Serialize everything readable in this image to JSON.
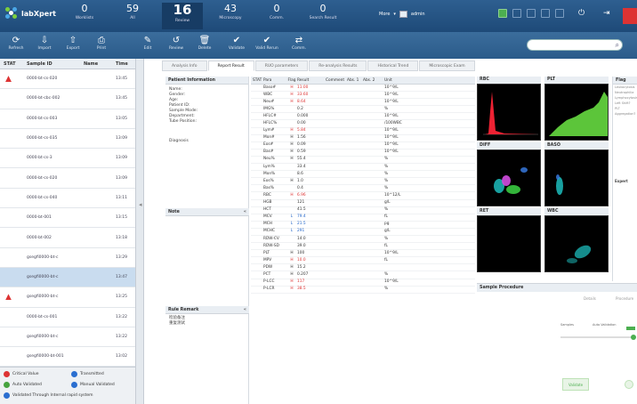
{
  "app": {
    "name": "labXpert",
    "colors": {
      "header": "#1e4a78",
      "accent": "#4caf50",
      "alert": "#d33333",
      "selected_row": "#c9dcef"
    }
  },
  "header": {
    "stats": [
      {
        "value": "0",
        "label": "Worklists"
      },
      {
        "value": "59",
        "label": "All"
      },
      {
        "value": "16",
        "label": "Review",
        "active": true
      },
      {
        "value": "43",
        "label": "Microscopy"
      },
      {
        "value": "0",
        "label": "Comm."
      },
      {
        "value": "0",
        "label": "Search Result"
      }
    ],
    "mode": "More",
    "user": "admin"
  },
  "toolbar": {
    "buttons": [
      {
        "label": "Refresh",
        "icon": "refresh-icon"
      },
      {
        "label": "Import",
        "icon": "import-icon"
      },
      {
        "label": "Export",
        "icon": "export-icon"
      },
      {
        "label": "Print",
        "icon": "print-icon"
      },
      {
        "label": "Edit",
        "icon": "edit-icon"
      },
      {
        "label": "Review",
        "icon": "review-icon"
      },
      {
        "label": "Delete",
        "icon": "delete-icon"
      },
      {
        "label": "Validate",
        "icon": "validate-icon"
      },
      {
        "label": "Valid Rerun",
        "icon": "valid-rerun-icon"
      },
      {
        "label": "Comm.",
        "icon": "communication-icon"
      }
    ]
  },
  "sample_list": {
    "columns": [
      "STAT",
      "Sample ID",
      "Name",
      "Time"
    ],
    "rows": [
      {
        "flag": true,
        "id": "0000-bt-cs-020",
        "time": "13:45"
      },
      {
        "flag": false,
        "id": "0000-bt-cbc-002",
        "time": "13:45"
      },
      {
        "flag": false,
        "id": "0000-bt-cs-003",
        "time": "13:05"
      },
      {
        "flag": false,
        "id": "0000-bt-cs-035",
        "time": "13:09"
      },
      {
        "flag": false,
        "id": "0000-bt-cs-3",
        "time": "13:09"
      },
      {
        "flag": false,
        "id": "0000-bt-cs-020",
        "time": "13:09"
      },
      {
        "flag": false,
        "id": "0000-bt-cs-040",
        "time": "13:11"
      },
      {
        "flag": false,
        "id": "0000-bt-001",
        "time": "13:15"
      },
      {
        "flag": false,
        "id": "0000-bt-002",
        "time": "13:18"
      },
      {
        "flag": false,
        "id": "gsegfi0000-bt-c",
        "time": "13:29"
      },
      {
        "flag": false,
        "id": "gsegfi0000-bt-c",
        "time": "13:47",
        "selected": true
      },
      {
        "flag": true,
        "id": "gsegfi0000-bt-c",
        "time": "13:25"
      },
      {
        "flag": false,
        "id": "0000-bt-cs-001",
        "time": "13:22"
      },
      {
        "flag": false,
        "id": "gsegfi0000-bt-c",
        "time": "13:22"
      },
      {
        "flag": false,
        "id": "gsegfi0000-bt-001",
        "time": "13:02"
      }
    ]
  },
  "legend": {
    "items": [
      {
        "label": "Critical Value",
        "color": "#d33333"
      },
      {
        "label": "Transmitted",
        "color": "#2b6fd0"
      },
      {
        "label": "Auto Validated",
        "color": "#46a33f"
      },
      {
        "label": "Manual Validated",
        "color": "#2b6fd0"
      },
      {
        "label": "Validated Through Internal rapid system",
        "color": "#2b6fd0"
      }
    ]
  },
  "tabs": [
    "Analysis Info",
    "Report Result",
    "RUO parameters",
    "Re-analysis Results",
    "Historical Trend",
    "Microscopic Exam"
  ],
  "active_tab": 1,
  "patient_info": {
    "title": "Patient Information",
    "fields": [
      "Name:",
      "Gender:",
      "Age:",
      "Patient ID:",
      "Sample Mode:",
      "Department:",
      "Tube Position:"
    ],
    "diagnosis": "Diagnosis",
    "note": "Note",
    "rule_remark": "Rule Remark",
    "rule_lines": [
      "检验备注",
      "重复测试"
    ]
  },
  "results": {
    "columns": [
      "STAT",
      "Para",
      "Flag",
      "Result",
      "Comment",
      "Abs. 1",
      "Abs. 2",
      "Unit"
    ],
    "rows": [
      {
        "para": "Baso#",
        "flag": "H",
        "result": "11.00",
        "unit": "10^9/L",
        "hi": true
      },
      {
        "para": "WBC",
        "flag": "H",
        "result": "33.60",
        "unit": "10^9/L",
        "hi": true
      },
      {
        "para": "Neu#",
        "flag": "H",
        "result": "8.64",
        "unit": "10^9/L",
        "hi": true
      },
      {
        "para": "IMG%",
        "flag": "",
        "result": "0.2",
        "unit": "%"
      },
      {
        "para": "HFLC#",
        "flag": "",
        "result": "0.000",
        "unit": "10^9/L"
      },
      {
        "para": "HFLC%",
        "flag": "",
        "result": "0.00",
        "unit": "/100WBC"
      },
      {
        "para": "Lym#",
        "flag": "H",
        "result": "5.84",
        "unit": "10^9/L",
        "hi": true
      },
      {
        "para": "Mon#",
        "flag": "H",
        "result": "1.56",
        "unit": "10^9/L"
      },
      {
        "para": "Eos#",
        "flag": "H",
        "result": "0.09",
        "unit": "10^9/L"
      },
      {
        "para": "Bas#",
        "flag": "H",
        "result": "0.59",
        "unit": "10^9/L"
      },
      {
        "para": "Neu%",
        "flag": "H",
        "result": "55.4",
        "unit": "%"
      },
      {
        "para": "Lym%",
        "flag": "",
        "result": "33.4",
        "unit": "%"
      },
      {
        "para": "Mon%",
        "flag": "",
        "result": "8.6",
        "unit": "%"
      },
      {
        "para": "Eos%",
        "flag": "H",
        "result": "1.0",
        "unit": "%"
      },
      {
        "para": "Bas%",
        "flag": "",
        "result": "0.4",
        "unit": "%"
      },
      {
        "para": "RBC",
        "flag": "H",
        "result": "6.96",
        "unit": "10^12/L",
        "hi": true
      },
      {
        "para": "HGB",
        "flag": "",
        "result": "121",
        "unit": "g/L"
      },
      {
        "para": "HCT",
        "flag": "",
        "result": "41.5",
        "unit": "%"
      },
      {
        "para": "MCV",
        "flag": "L",
        "result": "79.4",
        "unit": "fL",
        "lo": true
      },
      {
        "para": "MCH",
        "flag": "L",
        "result": "21.5",
        "unit": "pg",
        "lo": true
      },
      {
        "para": "MCHC",
        "flag": "L",
        "result": "291",
        "unit": "g/L",
        "lo": true
      },
      {
        "para": "RDW-CV",
        "flag": "",
        "result": "14.0",
        "unit": "%"
      },
      {
        "para": "RDW-SD",
        "flag": "",
        "result": "39.0",
        "unit": "fL"
      },
      {
        "para": "PLT",
        "flag": "H",
        "result": "100",
        "unit": "10^9/L"
      },
      {
        "para": "MPV",
        "flag": "H",
        "result": "10.0",
        "unit": "fL",
        "hi": true
      },
      {
        "para": "PDW",
        "flag": "H",
        "result": "15.2",
        "unit": ""
      },
      {
        "para": "PCT",
        "flag": "H",
        "result": "0.207",
        "unit": "%"
      },
      {
        "para": "P-LCC",
        "flag": "H",
        "result": "117",
        "unit": "10^9/L",
        "hi": true
      },
      {
        "para": "P-LCR",
        "flag": "H",
        "result": "38.5",
        "unit": "%",
        "hi": true
      }
    ]
  },
  "graphs": [
    "RBC",
    "PLT",
    "DIFF",
    "BASO",
    "RET",
    "WBC"
  ],
  "flags": {
    "title": "Flag",
    "items": [
      "Leukocytosis",
      "Neutrophilia",
      "Lymphocytosis",
      "Left Shift?",
      "PLT Aggregation?"
    ],
    "expert": "Expert"
  },
  "procedure": {
    "title": "Sample Procedure",
    "tabs": [
      "Details",
      "Procedure"
    ],
    "steps": [
      "Samples",
      "Auto Validation",
      "Review"
    ],
    "action": "Validate"
  }
}
